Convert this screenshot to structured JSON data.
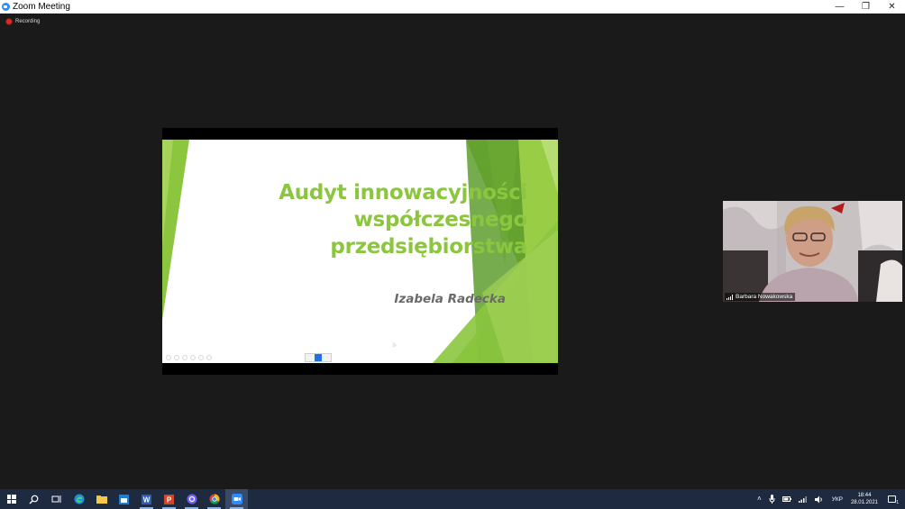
{
  "window": {
    "title": "Zoom Meeting",
    "controls": {
      "minimize": "—",
      "restore": "❐",
      "close": "✕"
    }
  },
  "recording": {
    "label": "Recording",
    "color": "#e02828"
  },
  "slide": {
    "title_lines": [
      "Audyt innowacyjności",
      "współczesnego",
      "przedsiębiorstwa"
    ],
    "author": "Izabela Radecka",
    "accent_color": "#8cc63f"
  },
  "participant": {
    "name": "Barbara Nowakowska"
  },
  "taskbar": {
    "lang": "УКР",
    "time": "18:44",
    "date": "28.01.2021",
    "notification_count": "1"
  }
}
